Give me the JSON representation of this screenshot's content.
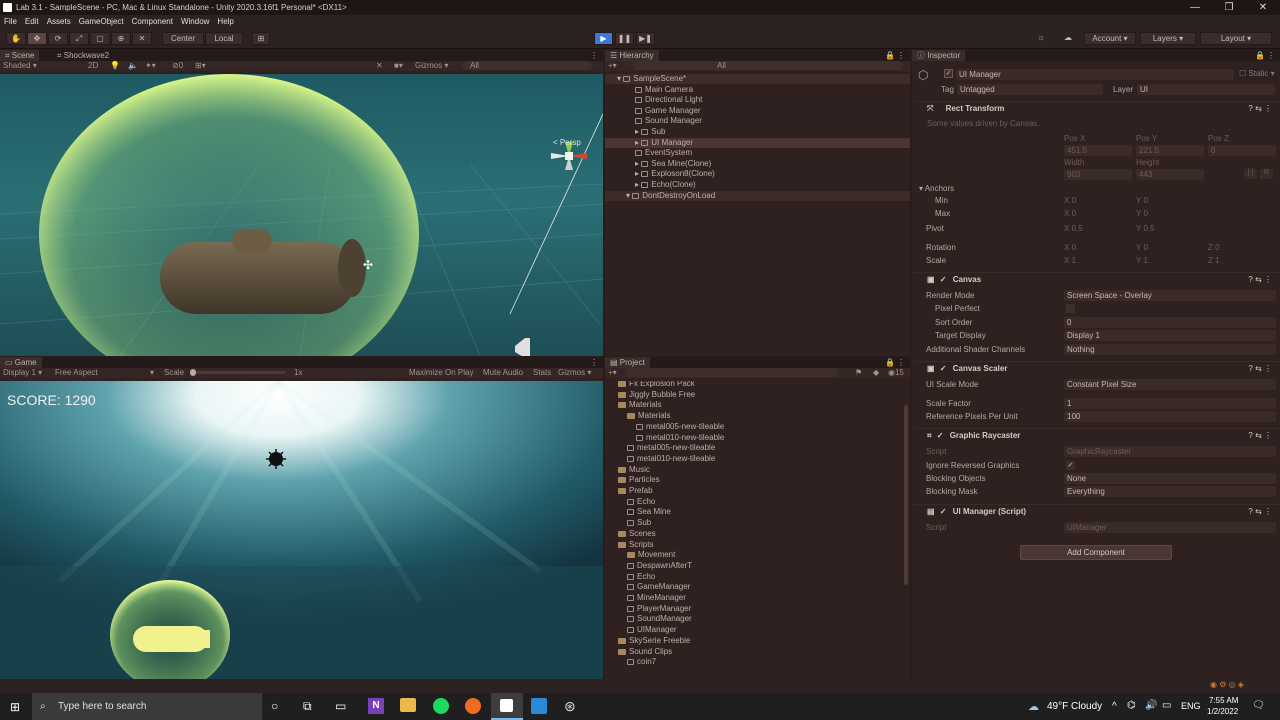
{
  "window": {
    "title": "Lab 3.1 - SampleScene - PC, Mac & Linux Standalone - Unity 2020.3.16f1 Personal* <DX11>",
    "min": "—",
    "max": "❐",
    "close": "✕"
  },
  "menu": [
    "File",
    "Edit",
    "Assets",
    "GameObject",
    "Component",
    "Window",
    "Help"
  ],
  "toolbar": {
    "center": "Center",
    "local": "Local",
    "play": "▶",
    "pause": "❚❚",
    "step": "▶❚",
    "account": "Account",
    "layers": "Layers",
    "layout": "Layout"
  },
  "scene": {
    "tab": "Scene",
    "tab2": "Shockwave2",
    "shading": "Shaded",
    "mode2d": "2D",
    "gizmos": "Gizmos",
    "search": "All",
    "persp": "< Persp",
    "fx_count": "0"
  },
  "game": {
    "tab": "Game",
    "display": "Display 1",
    "aspect": "Free Aspect",
    "scale_label": "Scale",
    "scale_value": "1x",
    "maximize": "Maximize On Play",
    "mute": "Mute Audio",
    "stats": "Stats",
    "gizmos": "Gizmos",
    "score": "SCORE: 1290"
  },
  "hierarchy": {
    "tab": "Hierarchy",
    "search": "All",
    "items": [
      {
        "label": "SampleScene*",
        "indent": 0
      },
      {
        "label": "Main Camera",
        "indent": 2
      },
      {
        "label": "Directional Light",
        "indent": 2
      },
      {
        "label": "Game Manager",
        "indent": 2
      },
      {
        "label": "Sound Manager",
        "indent": 2
      },
      {
        "label": "Sub",
        "indent": 2
      },
      {
        "label": "UI Manager",
        "indent": 2
      },
      {
        "label": "EventSystem",
        "indent": 2
      },
      {
        "label": "Sea Mine(Clone)",
        "indent": 2
      },
      {
        "label": "Exploson8(Clone)",
        "indent": 2
      },
      {
        "label": "Echo(Clone)",
        "indent": 2
      },
      {
        "label": "DontDestroyOnLoad",
        "indent": 1
      }
    ]
  },
  "project": {
    "tab": "Project",
    "count": "15",
    "items": [
      {
        "label": "Fx Explosion Pack",
        "indent": 1,
        "kind": "folder"
      },
      {
        "label": "Jiggly Bubble Free",
        "indent": 1,
        "kind": "folder"
      },
      {
        "label": "Materials",
        "indent": 1,
        "kind": "folder"
      },
      {
        "label": "Materials",
        "indent": 2,
        "kind": "folder"
      },
      {
        "label": "metal005-new-tileable",
        "indent": 3,
        "kind": "asset"
      },
      {
        "label": "metal010-new-tileable",
        "indent": 3,
        "kind": "asset"
      },
      {
        "label": "metal005-new-tileable",
        "indent": 2,
        "kind": "asset"
      },
      {
        "label": "metal010-new-tileable",
        "indent": 2,
        "kind": "asset"
      },
      {
        "label": "Music",
        "indent": 1,
        "kind": "folder"
      },
      {
        "label": "Particles",
        "indent": 1,
        "kind": "folder"
      },
      {
        "label": "Prefab",
        "indent": 1,
        "kind": "folder"
      },
      {
        "label": "Echo",
        "indent": 2,
        "kind": "asset"
      },
      {
        "label": "Sea Mine",
        "indent": 2,
        "kind": "asset"
      },
      {
        "label": "Sub",
        "indent": 2,
        "kind": "asset"
      },
      {
        "label": "Scenes",
        "indent": 1,
        "kind": "folder"
      },
      {
        "label": "Scripts",
        "indent": 1,
        "kind": "folder"
      },
      {
        "label": "Movement",
        "indent": 2,
        "kind": "folder"
      },
      {
        "label": "DespawnAfterT",
        "indent": 2,
        "kind": "asset"
      },
      {
        "label": "Echo",
        "indent": 2,
        "kind": "asset"
      },
      {
        "label": "GameManager",
        "indent": 2,
        "kind": "asset"
      },
      {
        "label": "MineManager",
        "indent": 2,
        "kind": "asset"
      },
      {
        "label": "PlayerManager",
        "indent": 2,
        "kind": "asset"
      },
      {
        "label": "SoundManager",
        "indent": 2,
        "kind": "asset"
      },
      {
        "label": "UIManager",
        "indent": 2,
        "kind": "asset"
      },
      {
        "label": "SkySerie Freebie",
        "indent": 1,
        "kind": "folder"
      },
      {
        "label": "Sound Clips",
        "indent": 1,
        "kind": "folder"
      },
      {
        "label": "coin7",
        "indent": 2,
        "kind": "asset"
      }
    ]
  },
  "inspector": {
    "tab": "Inspector",
    "object_name": "UI Manager",
    "static": "Static",
    "tag_label": "Tag",
    "tag_value": "Untagged",
    "layer_label": "Layer",
    "layer_value": "UI",
    "rect": {
      "title": "Rect Transform",
      "note": "Some values driven by Canvas.",
      "posx_l": "Pos X",
      "posy_l": "Pos Y",
      "posz_l": "Pos Z",
      "posx": "451.5",
      "posy": "221.5",
      "posz": "0",
      "width_l": "Width",
      "height_l": "Height",
      "width": "903",
      "height": "443",
      "anchors": "Anchors",
      "min": "Min",
      "max": "Max",
      "min_x": "0",
      "min_y": "0",
      "max_x": "0",
      "max_y": "0",
      "pivot": "Pivot",
      "pivot_x": "0.5",
      "pivot_y": "0.5",
      "rotation": "Rotation",
      "rot_x": "0",
      "rot_y": "0",
      "rot_z": "0",
      "scale": "Scale",
      "sc_x": "1",
      "sc_y": "1",
      "sc_z": "1",
      "x": "X",
      "y": "Y",
      "z": "Z",
      "r": "R"
    },
    "canvas": {
      "title": "Canvas",
      "render_mode_l": "Render Mode",
      "render_mode": "Screen Space - Overlay",
      "pixel_perfect_l": "Pixel Perfect",
      "sort_order_l": "Sort Order",
      "sort_order": "0",
      "target_display_l": "Target Display",
      "target_display": "Display 1",
      "additional_l": "Additional Shader Channels",
      "additional": "Nothing"
    },
    "scaler": {
      "title": "Canvas Scaler",
      "mode_l": "UI Scale Mode",
      "mode": "Constant Pixel Size",
      "factor_l": "Scale Factor",
      "factor": "1",
      "ref_l": "Reference Pixels Per Unit",
      "ref": "100"
    },
    "raycaster": {
      "title": "Graphic Raycaster",
      "script_l": "Script",
      "script": "GraphicRaycaster",
      "ignore_l": "Ignore Reversed Graphics",
      "ignore": "✓",
      "blocking_l": "Blocking Objects",
      "blocking": "None",
      "mask_l": "Blocking Mask",
      "mask": "Everything"
    },
    "uiscript": {
      "title": "UI Manager (Script)",
      "script_l": "Script",
      "script": "UIManager"
    },
    "add_component": "Add Component"
  },
  "taskbar": {
    "search": "Type here to search",
    "weather": "49°F  Cloudy",
    "lang": "ENG",
    "time": "7:55 AM",
    "date": "1/2/2022",
    "notif": "1"
  },
  "colors": {
    "accent": "#3b78d8",
    "selection": "#4a3533"
  }
}
